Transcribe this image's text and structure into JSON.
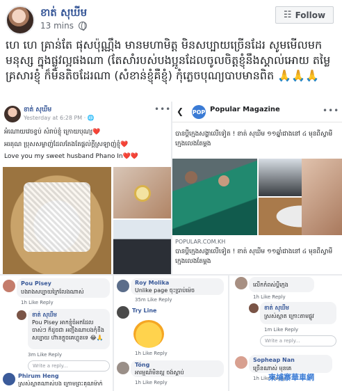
{
  "header": {
    "author": "ខាត់ សុឃីម",
    "time": "13 mins",
    "follow_label": "Follow"
  },
  "post": {
    "text": "ហេ ហេ គ្រាន់តែ ផុសប៉ុណ្ណឹង មានមហាមិត្ត មិនសប្បាយច្រើនដែរ សូមមើលមកមនុស្ស ក្នុងផ្លូវល្អផងណា (តែសាំរបស់បងប្អូនដែលចូលចិត្តខ្ញុំនឹងស្គាល់អោយ តម្លៃគ្រសារខ្ញុំ ក៏មិនតិចដែរណា (សំខាន់ខ្ញុំគឺខ្ញុំ) កុំភ្លេចបុណ្យបាបមានពិត 🙏🙏🙏"
  },
  "tile1": {
    "name": "ខាត់ សុឃីម",
    "time": "Yesterday at 6:28 PM · 🌐",
    "lines": [
      "អំណោយវេចខ្ចប់ សំរាប់ខ្ញុំ ក្រោយបុណ្យ❤️",
      "អរគុណ ប្រុសសម្លាញ់ដែលតែងតែផ្ដល់ក្ដីស្រឡាញ់ខ្ញុំ❤️",
      "Love you my sweet husband Phano In❤️❤️"
    ]
  },
  "tile2": {
    "logo": "POP",
    "page_name": "Popular Magazine",
    "text": "បានប្តីក្មេងសង្ហាលើទៀត ! ខាត់ សុឃីម ១១ឆ្នាំជាងនៅ ៤ មុនពីស្វាមីក្មេងលេងតែម្ដង",
    "domain": "POPULAR.COM.KH",
    "link_title": "បានប្តីក្មេងសង្ហាលើទៀត ! ខាត់ សុឃីម ១១ឆ្នាំជាងនៅ ៤ មុនពីស្វាមីក្មេងលេងតែម្ដង"
  },
  "tile3": {
    "c1_name": "Pou Pisey",
    "c1_text": "បងរាងសប្បាយក្រៃលែងណាស់",
    "c1_meta": "1h   Like   Reply",
    "r_name": "ខាត់ សុឃីម",
    "r_text": "Pou Pisey  អាកខ្ញុំចំអកដែលចាស់ៗ ក៏ដូចជា អញ្ជឹងណាបងកុំខឹង សប្បាយ ហ៊ានក្ដូចគេហ្គូនទេ 😂🙏",
    "r_meta": "3m   Like   Reply",
    "write": "Write a reply...",
    "c2_name": "Phirum Heng",
    "c2_text": "ស្រស់ស្អាតណាស់បង ក្រោមព្រះគុណម៉ាក់",
    "c2_meta": "1h   Like   Reply"
  },
  "tile4": {
    "c1_name": "Roy Molika",
    "c1_text": "Unlike page ចុះប្រាប់ម៉េច",
    "c1_meta": "35m   Like   Reply",
    "c2_name": "Try Line",
    "c2_meta": "1h   Like   Reply",
    "c3_name": "Tóng",
    "c3_text": "អារម្មណ៍មិនល្អ ចង់ស្តាប់",
    "c3_meta": "1h   Like   Reply"
  },
  "tile5": {
    "c1_text": "លើកកំពស់ប្តីក្មេង",
    "c1_meta": "1h   Like   Reply",
    "r_name": "ខាត់ សុឃីម",
    "r_text": "ស្រស់ស្អាត ក្រោះតាមផ្លូវ",
    "r_meta": "1m   Like   Reply",
    "write": "Write a reply...",
    "c2_name": "Sopheap Nan",
    "c2_text": "ច្រើនណាស់ មុនគេ",
    "c2_meta": "1h   Like   Reply"
  },
  "watermark": "柬埔寨華車網",
  "colors": {
    "link": "#385898",
    "bg": "#e9ebee"
  }
}
